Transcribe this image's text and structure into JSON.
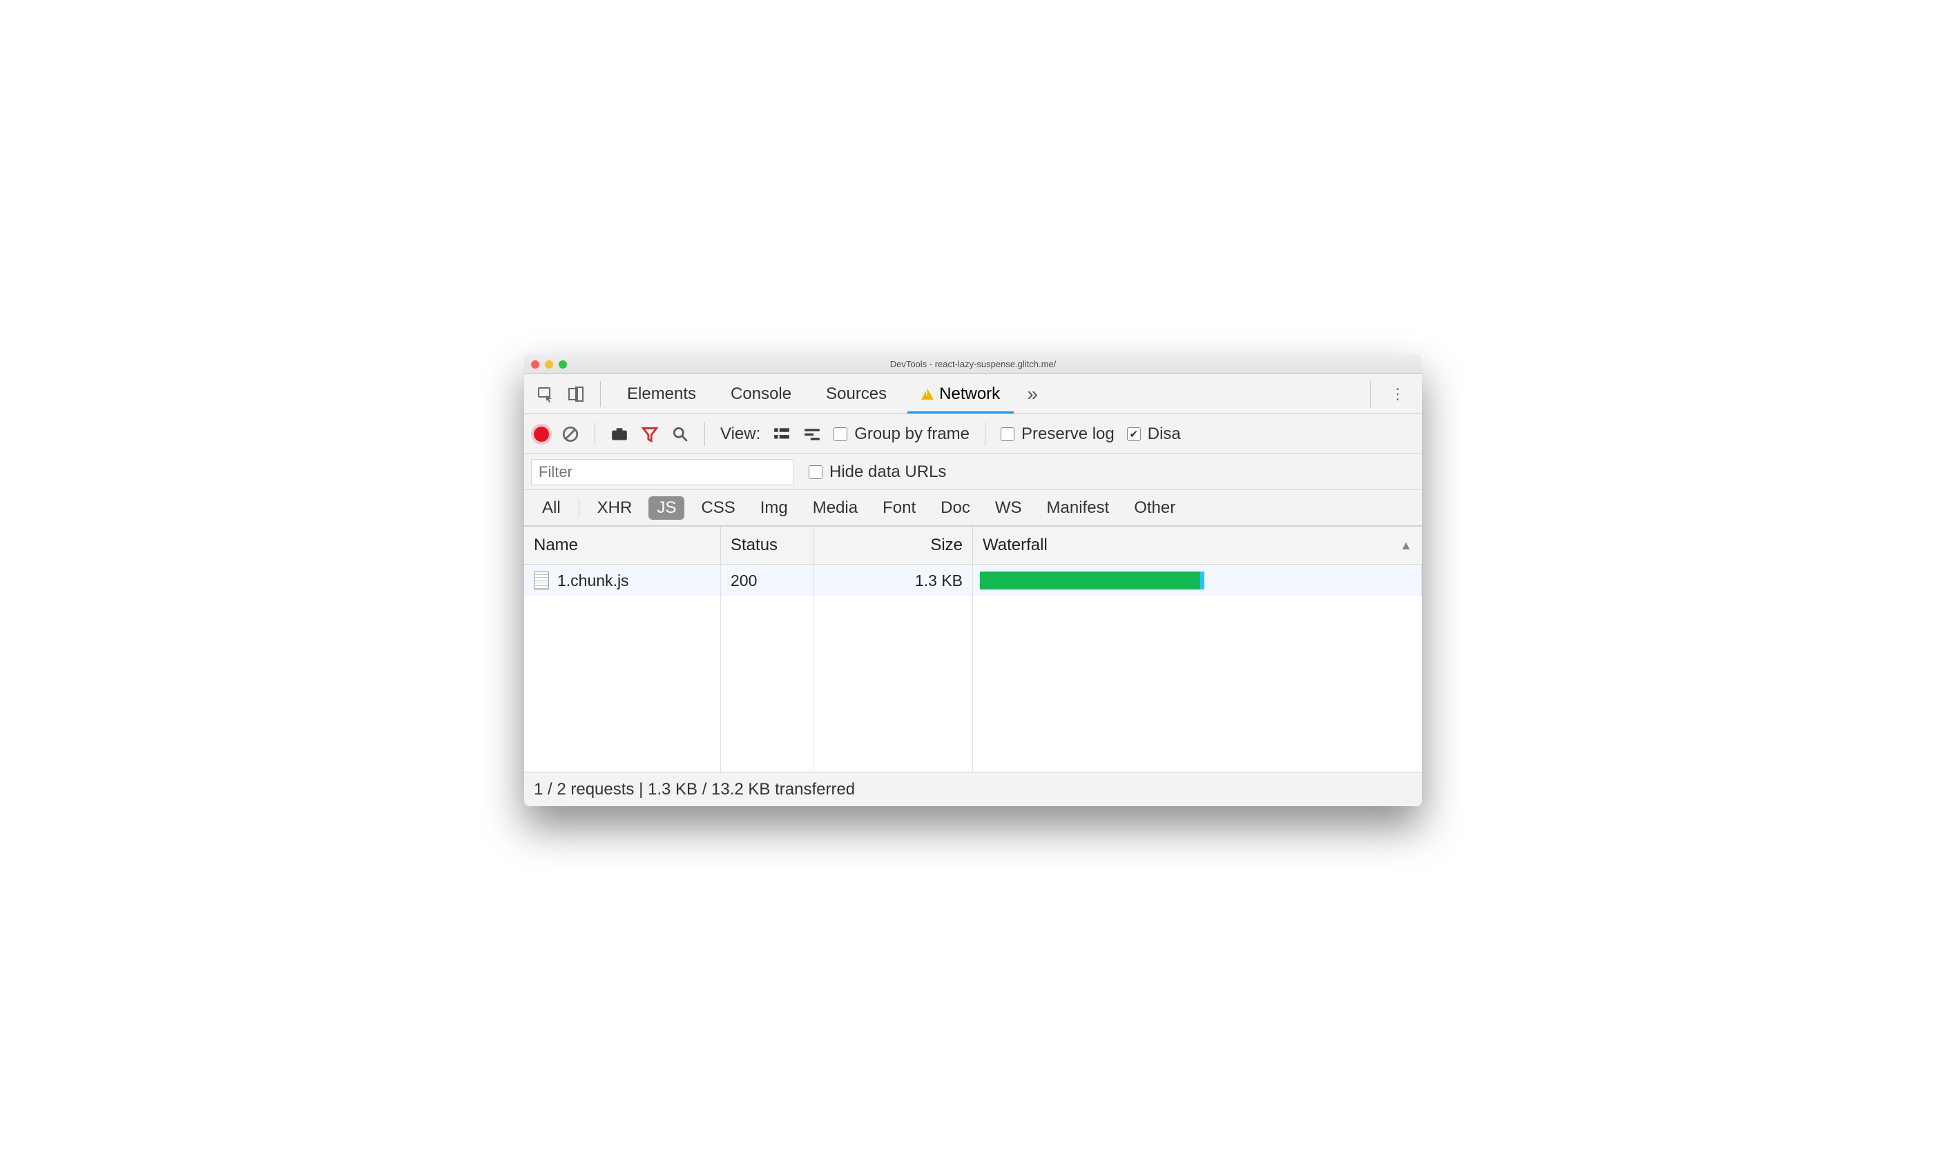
{
  "window_title": "DevTools - react-lazy-suspense.glitch.me/",
  "tabs": {
    "elements": "Elements",
    "console": "Console",
    "sources": "Sources",
    "network": "Network"
  },
  "toolbar": {
    "view_label": "View:",
    "group_by_frame": "Group by frame",
    "preserve_log": "Preserve log",
    "disable_cache_truncated": "Disa"
  },
  "filter": {
    "placeholder": "Filter",
    "hide_data_urls": "Hide data URLs"
  },
  "types": [
    "All",
    "XHR",
    "JS",
    "CSS",
    "Img",
    "Media",
    "Font",
    "Doc",
    "WS",
    "Manifest",
    "Other"
  ],
  "types_selected": "JS",
  "columns": {
    "name": "Name",
    "status": "Status",
    "size": "Size",
    "waterfall": "Waterfall"
  },
  "rows": [
    {
      "name": "1.chunk.js",
      "status": "200",
      "size": "1.3 KB",
      "waterfall_pct": 50
    }
  ],
  "status_text": "1 / 2 requests | 1.3 KB / 13.2 KB transferred"
}
